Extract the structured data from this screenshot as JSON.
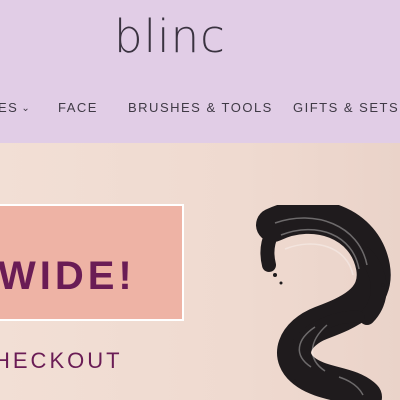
{
  "brand": {
    "logo_text": "blinc"
  },
  "nav": {
    "items": [
      {
        "label": "ES",
        "has_dropdown": true,
        "chevron": "⌄"
      },
      {
        "label": "FACE"
      },
      {
        "label": "BRUSHES & TOOLS"
      },
      {
        "label": "GIFTS & SETS"
      }
    ]
  },
  "hero": {
    "headline": "WIDE!",
    "subline": "HECKOUT",
    "image": "mascara-brush-stroke"
  },
  "colors": {
    "header_bg": "#e1cde6",
    "hero_bg": "#f1ddd3",
    "promo_box": "#eeb3a5",
    "accent_text": "#6a1c55"
  }
}
